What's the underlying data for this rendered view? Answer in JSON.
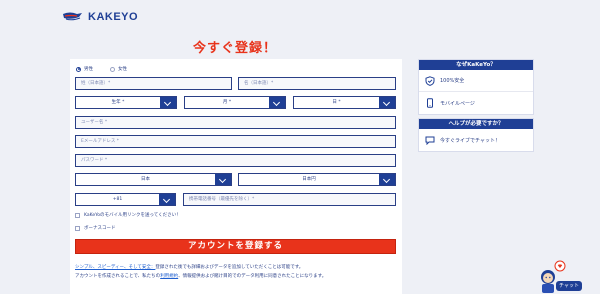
{
  "brand": {
    "name": "KAKEYO"
  },
  "page": {
    "title": "今すぐ登録！"
  },
  "form": {
    "gender": {
      "male": "男性",
      "female": "女性",
      "selected": "male"
    },
    "last_name_placeholder": "姓（日本語）*",
    "first_name_placeholder": "名（日本語）*",
    "birth_year": "生年 *",
    "birth_month": "月 *",
    "birth_day": "日 *",
    "username_placeholder": "ユーザー名 *",
    "email_placeholder": "Eメールアドレス *",
    "password_placeholder": "パスワード *",
    "country": "日本",
    "currency": "日本円",
    "phone_code": "+81",
    "phone_placeholder": "携帯電話番号（最優先を除く）*",
    "sms_consent": "KaKeYoのモバイル用リンクを送ってください！",
    "bonus_code": "ボーナスコード",
    "submit_label": "アカウントを登録する"
  },
  "terms": {
    "line1_pre": "シンプル、スピーディー、そして安全：",
    "line1_post": "登録された後でも詳細およびデータを追加していただくことは可能です。",
    "line2_pre": "アカウントを作成されることで、私たちの",
    "line2_link": "利用規約",
    "line2_post": "、情報提供および賭け目的でのデータ利用に同意されたことになります。"
  },
  "sidebar": {
    "why_title": "なぜKaKeYo？",
    "why_items": [
      "100%安全",
      "モバイルページ"
    ],
    "help_title": "ヘルプが必要ですか？",
    "help_items": [
      "今すぐライブでチャット！"
    ]
  },
  "chat": {
    "label": "チャット"
  },
  "colors": {
    "brand": "#1f3f95",
    "accent": "#e8331b",
    "background": "#eef0f6"
  }
}
